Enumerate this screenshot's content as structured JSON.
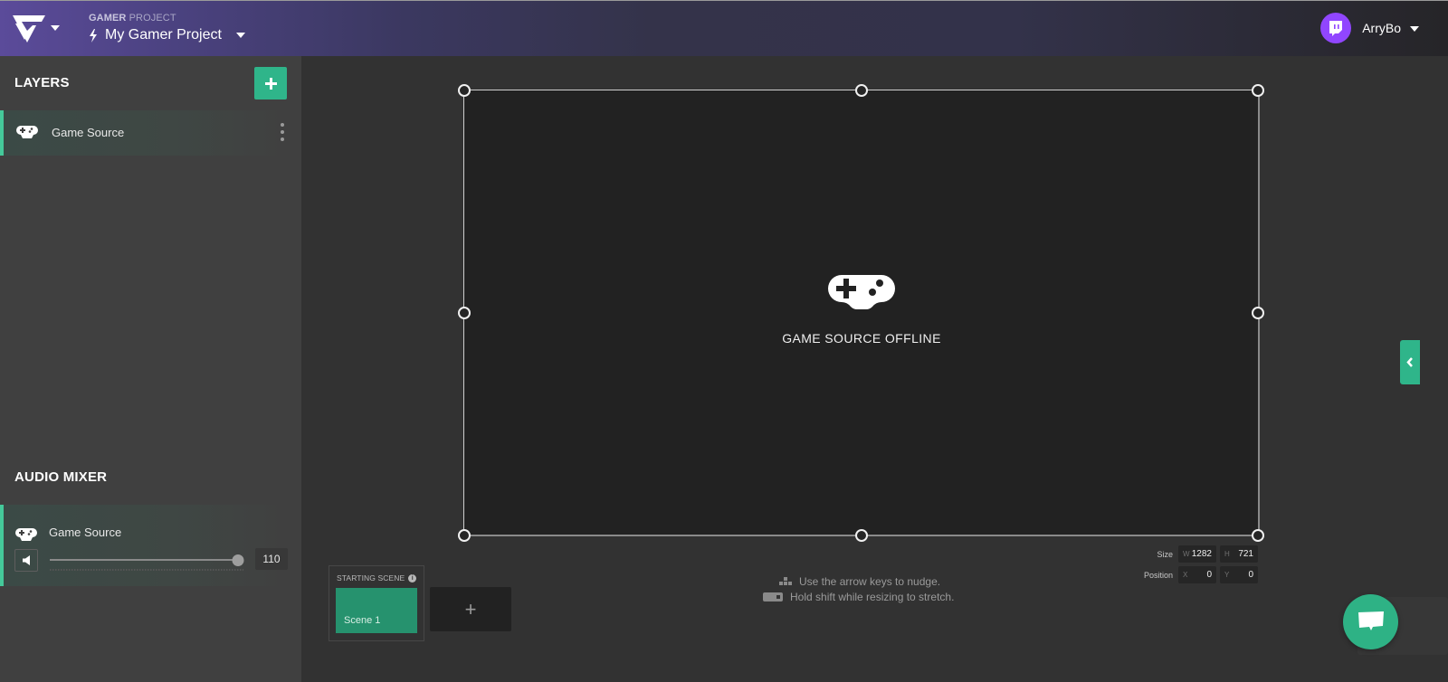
{
  "header": {
    "project_label_bold": "GAMER",
    "project_label_rest": " PROJECT",
    "project_name": "My Gamer Project",
    "user_name": "ArryBo",
    "brand_color": "#5b4b9a"
  },
  "sidebar": {
    "layers_title": "LAYERS",
    "add_layer_label": "+",
    "layers": [
      {
        "label": "Game Source",
        "icon": "gamepad-icon"
      }
    ],
    "audio_title": "AUDIO MIXER",
    "audio_sources": [
      {
        "label": "Game Source",
        "icon": "gamepad-icon",
        "volume": "110",
        "volume_fraction": 0.97
      }
    ],
    "accent_color": "#45c99a"
  },
  "canvas": {
    "offline_text": "GAME SOURCE OFFLINE",
    "size_label": "Size",
    "position_label": "Position",
    "width_key": "W",
    "width_value": "1282",
    "height_key": "H",
    "height_value": "721",
    "x_key": "X",
    "x_value": "0",
    "y_key": "Y",
    "y_value": "0",
    "hint_nudge": "Use the arrow keys to nudge.",
    "hint_stretch": "Hold shift while resizing to stretch."
  },
  "scenes": {
    "starting_scene_label": "STARTING SCENE",
    "info_icon": "i",
    "items": [
      {
        "label": "Scene 1"
      }
    ],
    "add_scene_label": "+",
    "scene_color": "#26926e"
  }
}
